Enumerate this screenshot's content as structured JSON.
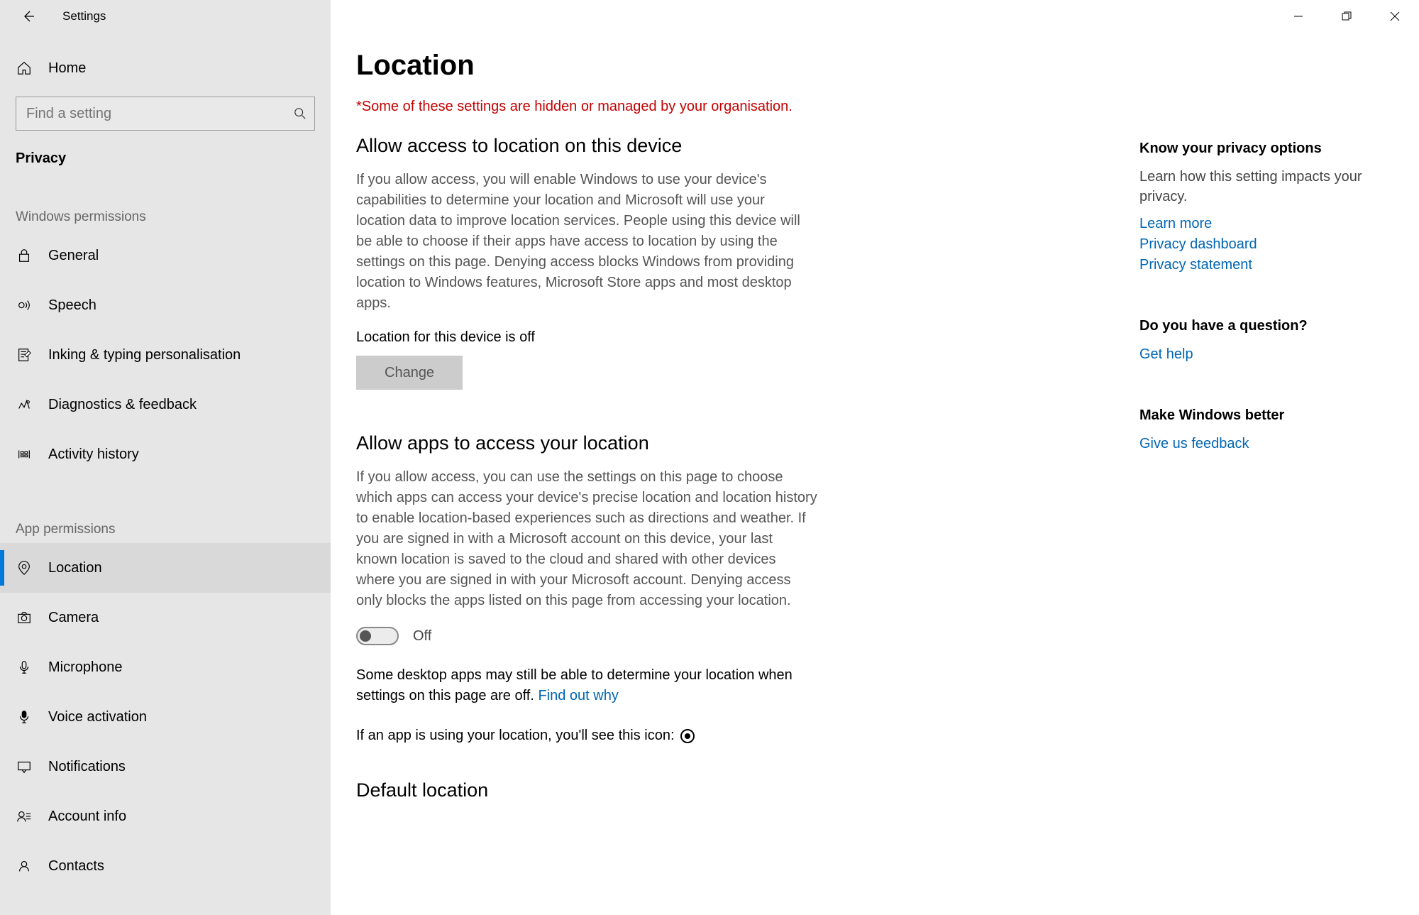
{
  "app_title": "Settings",
  "home_label": "Home",
  "search_placeholder": "Find a setting",
  "section_title": "Privacy",
  "groups": [
    {
      "label": "Windows permissions",
      "items": [
        {
          "label": "General",
          "icon": "lock"
        },
        {
          "label": "Speech",
          "icon": "speech"
        },
        {
          "label": "Inking & typing personalisation",
          "icon": "inking"
        },
        {
          "label": "Diagnostics & feedback",
          "icon": "diagnostics"
        },
        {
          "label": "Activity history",
          "icon": "activity"
        }
      ]
    },
    {
      "label": "App permissions",
      "items": [
        {
          "label": "Location",
          "icon": "location",
          "selected": true
        },
        {
          "label": "Camera",
          "icon": "camera"
        },
        {
          "label": "Microphone",
          "icon": "microphone"
        },
        {
          "label": "Voice activation",
          "icon": "voice"
        },
        {
          "label": "Notifications",
          "icon": "notifications"
        },
        {
          "label": "Account info",
          "icon": "account"
        },
        {
          "label": "Contacts",
          "icon": "contacts"
        }
      ]
    }
  ],
  "page": {
    "title": "Location",
    "policy_notice": "*Some of these settings are hidden or managed by your organisation.",
    "section1": {
      "heading": "Allow access to location on this device",
      "body": "If you allow access, you will enable Windows to use your device's capabilities to determine your location and Microsoft will use your location data to improve location services. People using this device will be able to choose if their apps have access to location by using the settings on this page. Denying access blocks Windows from providing location to Windows features, Microsoft Store apps and most desktop apps.",
      "status": "Location for this device is off",
      "button": "Change"
    },
    "section2": {
      "heading": "Allow apps to access your location",
      "body": "If you allow access, you can use the settings on this page to choose which apps can access your device's precise location and location history to enable location-based experiences such as directions and weather. If you are signed in with a Microsoft account on this device, your last known location is saved to the cloud and shared with other devices where you are signed in with your Microsoft account. Denying access only blocks the apps listed on this page from accessing your location.",
      "toggle_state": "Off",
      "desktop_note_prefix": "Some desktop apps may still be able to determine your location when settings on this page are off. ",
      "desktop_note_link": "Find out why",
      "indicator_text": "If an app is using your location, you'll see this icon:"
    },
    "section3": {
      "heading": "Default location"
    }
  },
  "aside": {
    "block1": {
      "heading": "Know your privacy options",
      "text": "Learn how this setting impacts your privacy.",
      "links": [
        "Learn more",
        "Privacy dashboard",
        "Privacy statement"
      ]
    },
    "block2": {
      "heading": "Do you have a question?",
      "links": [
        "Get help"
      ]
    },
    "block3": {
      "heading": "Make Windows better",
      "links": [
        "Give us feedback"
      ]
    }
  }
}
